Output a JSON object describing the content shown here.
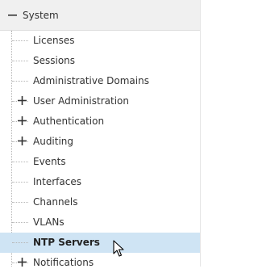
{
  "tree": {
    "root": {
      "label": "System",
      "expanded": true
    },
    "items": [
      {
        "label": "Licenses",
        "expandable": false,
        "selected": false
      },
      {
        "label": "Sessions",
        "expandable": false,
        "selected": false
      },
      {
        "label": "Administrative Domains",
        "expandable": false,
        "selected": false
      },
      {
        "label": "User Administration",
        "expandable": true,
        "selected": false
      },
      {
        "label": "Authentication",
        "expandable": true,
        "selected": false
      },
      {
        "label": "Auditing",
        "expandable": true,
        "selected": false
      },
      {
        "label": "Events",
        "expandable": false,
        "selected": false
      },
      {
        "label": "Interfaces",
        "expandable": false,
        "selected": false
      },
      {
        "label": "Channels",
        "expandable": false,
        "selected": false
      },
      {
        "label": "VLANs",
        "expandable": false,
        "selected": false
      },
      {
        "label": "NTP Servers",
        "expandable": false,
        "selected": true
      },
      {
        "label": "Notifications",
        "expandable": true,
        "selected": false
      }
    ]
  },
  "colors": {
    "header_bg": "#f0f0f0",
    "selected_bg": "#cfe4f4",
    "text": "#333333",
    "guide": "#b5b5b5"
  },
  "icons": {
    "collapse": "minus-icon",
    "expand": "plus-icon",
    "pointer": "mouse-cursor-icon"
  }
}
